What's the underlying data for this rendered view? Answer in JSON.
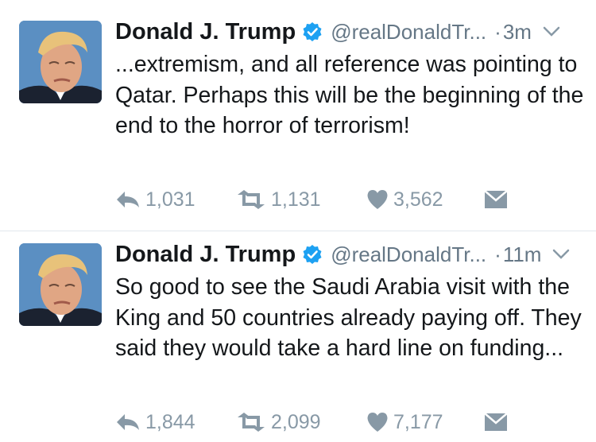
{
  "colors": {
    "text": "#14171a",
    "secondary": "#657786",
    "action": "#8899a6",
    "verified": "#1da1f2",
    "divider": "#e1e8ed"
  },
  "tweets": [
    {
      "name": "Donald J. Trump",
      "handle": "@realDonaldTr...",
      "dot": "·",
      "time": "3m",
      "text": "...extremism, and all reference was pointing to Qatar. Perhaps this will be the beginning of the end to the horror of terrorism!",
      "replies": "1,031",
      "retweets": "1,131",
      "likes": "3,562"
    },
    {
      "name": "Donald J. Trump",
      "handle": "@realDonaldTr...",
      "dot": "·",
      "time": "11m",
      "text": "So good to see the Saudi Arabia visit with the King and 50 countries already paying off. They said they would take a hard line on funding...",
      "replies": "1,844",
      "retweets": "2,099",
      "likes": "7,177"
    }
  ],
  "icons": {
    "verified": "verified-badge-icon",
    "menu": "chevron-down-icon",
    "reply": "reply-icon",
    "retweet": "retweet-icon",
    "like": "heart-icon",
    "dm": "envelope-icon"
  }
}
